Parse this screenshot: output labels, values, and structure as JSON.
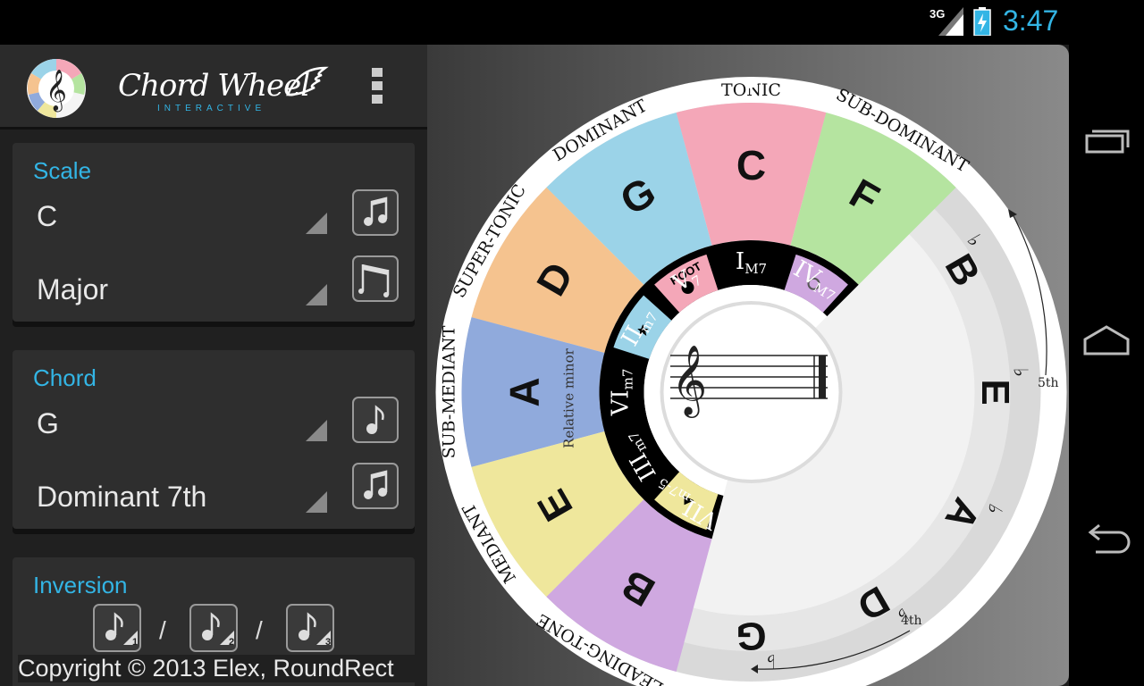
{
  "status": {
    "network": "3G",
    "time": "3:47"
  },
  "app": {
    "title": "Chord Wheel",
    "subtitle": "INTERACTIVE"
  },
  "scale": {
    "label": "Scale",
    "key": "C",
    "mode": "Major"
  },
  "chord": {
    "label": "Chord",
    "root": "G",
    "type": "Dominant 7th"
  },
  "inversion": {
    "label": "Inversion",
    "slash": "/",
    "badges": [
      "1",
      "2",
      "3"
    ]
  },
  "copyright": "Copyright © 2013 Elex, RoundRect",
  "wheel": {
    "functions": [
      {
        "label": "TONIC",
        "angle": 0
      },
      {
        "label": "SUB-DOMINANT",
        "angle": 30
      },
      {
        "label": "DOMINANT",
        "angle": -30
      },
      {
        "label": "SUPER-TONIC",
        "angle": -60
      },
      {
        "label": "SUB-MEDIANT",
        "angle": -90
      },
      {
        "label": "MEDIANT",
        "angle": -120
      },
      {
        "label": "LEADING-TONE",
        "angle": -150
      }
    ],
    "keys": [
      {
        "label": "C",
        "angle": 0,
        "color": "#f4a7b8"
      },
      {
        "label": "G",
        "angle": -30,
        "color": "#9bd3e8"
      },
      {
        "label": "D",
        "angle": -60,
        "color": "#f5c38f"
      },
      {
        "label": "A",
        "angle": -90,
        "color": "#90aadc"
      },
      {
        "label": "E",
        "angle": -120,
        "color": "#efe79c"
      },
      {
        "label": "B",
        "angle": -150,
        "color": "#cfa8e0"
      },
      {
        "label": "F",
        "angle": 30,
        "color": "#b5e4a0"
      }
    ],
    "grey_keys": [
      {
        "label": "B",
        "flat": "♭",
        "angle": 60
      },
      {
        "label": "E",
        "flat": "♭",
        "angle": 90
      },
      {
        "label": "A",
        "flat": "♭",
        "angle": 120
      },
      {
        "label": "D",
        "flat": "♭",
        "angle": 150
      },
      {
        "label": "G",
        "flat": "♭",
        "angle": 180
      }
    ],
    "numerals": [
      {
        "label": "I",
        "sub": "M7",
        "angle": 0
      },
      {
        "label": "IV",
        "sub": "M7",
        "angle": 30
      },
      {
        "label": "V",
        "sub": "7",
        "angle": -30
      },
      {
        "label": "II",
        "sub": "m7",
        "angle": -60
      },
      {
        "label": "VI",
        "sub": "m7",
        "angle": -90
      },
      {
        "label": "III",
        "sub": "m7",
        "angle": -120
      },
      {
        "label": "VII",
        "sub": "m7-5",
        "angle": -150
      }
    ],
    "relative_minor": "Relative minor",
    "root_label": "ROOT",
    "fifth_label": "5th",
    "fourth_label": "4th",
    "accent_colors": {
      "ring": "#000000",
      "rim": "#ffffff",
      "grey": "#d8d8d8",
      "accent": "#33b5e5"
    }
  }
}
